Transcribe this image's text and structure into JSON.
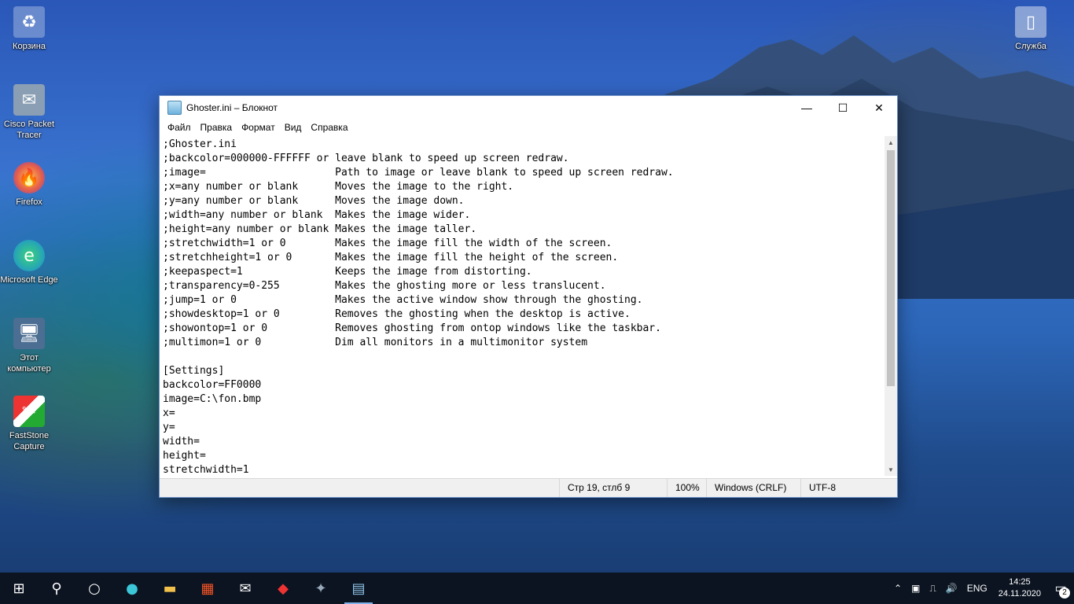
{
  "desktop": {
    "icons": [
      {
        "label": "Корзина",
        "icon": "recycle-bin-icon"
      },
      {
        "label": "Cisco Packet Tracer",
        "icon": "cisco-packet-tracer-icon"
      },
      {
        "label": "Firefox",
        "icon": "firefox-icon"
      },
      {
        "label": "Microsoft Edge",
        "icon": "edge-icon"
      },
      {
        "label": "Этот компьютер",
        "icon": "this-pc-icon"
      },
      {
        "label": "FastStone Capture",
        "icon": "faststone-capture-icon"
      },
      {
        "label": "Служба",
        "icon": "service-folder-icon"
      }
    ]
  },
  "window": {
    "title": "Ghoster.ini – Блокнот",
    "controls": {
      "minimize": "—",
      "maximize": "☐",
      "close": "✕"
    },
    "menu": [
      "Файл",
      "Правка",
      "Формат",
      "Вид",
      "Справка"
    ],
    "content": ";Ghoster.ini\n;backcolor=000000-FFFFFF or leave blank to speed up screen redraw.\n;image=                     Path to image or leave blank to speed up screen redraw.\n;x=any number or blank      Moves the image to the right.\n;y=any number or blank      Moves the image down.\n;width=any number or blank  Makes the image wider.\n;height=any number or blank Makes the image taller.\n;stretchwidth=1 or 0        Makes the image fill the width of the screen.\n;stretchheight=1 or 0       Makes the image fill the height of the screen.\n;keepaspect=1               Keeps the image from distorting.\n;transparency=0-255         Makes the ghosting more or less translucent.\n;jump=1 or 0                Makes the active window show through the ghosting.\n;showdesktop=1 or 0         Removes the ghosting when the desktop is active.\n;showontop=1 or 0           Removes ghosting from ontop windows like the taskbar.\n;multimon=1 or 0            Dim all monitors in a multimonitor system\n\n[Settings]\nbackcolor=FF0000\nimage=C:\\fon.bmp\nx=\ny=\nwidth=\nheight=\nstretchwidth=1",
    "status": {
      "position": "Стр 19, стлб 9",
      "zoom": "100%",
      "line_ending": "Windows (CRLF)",
      "encoding": "UTF-8"
    }
  },
  "taskbar": {
    "apps": [
      {
        "icon": "start-icon"
      },
      {
        "icon": "search-icon"
      },
      {
        "icon": "task-view-icon"
      },
      {
        "icon": "edge-icon"
      },
      {
        "icon": "file-explorer-icon"
      },
      {
        "icon": "store-icon"
      },
      {
        "icon": "mail-icon"
      },
      {
        "icon": "faststone-icon"
      },
      {
        "icon": "packet-tracer-icon"
      },
      {
        "icon": "notepad-icon"
      }
    ],
    "tray": {
      "language": "ENG",
      "time": "14:25",
      "date": "24.11.2020",
      "notifications": "2"
    }
  }
}
